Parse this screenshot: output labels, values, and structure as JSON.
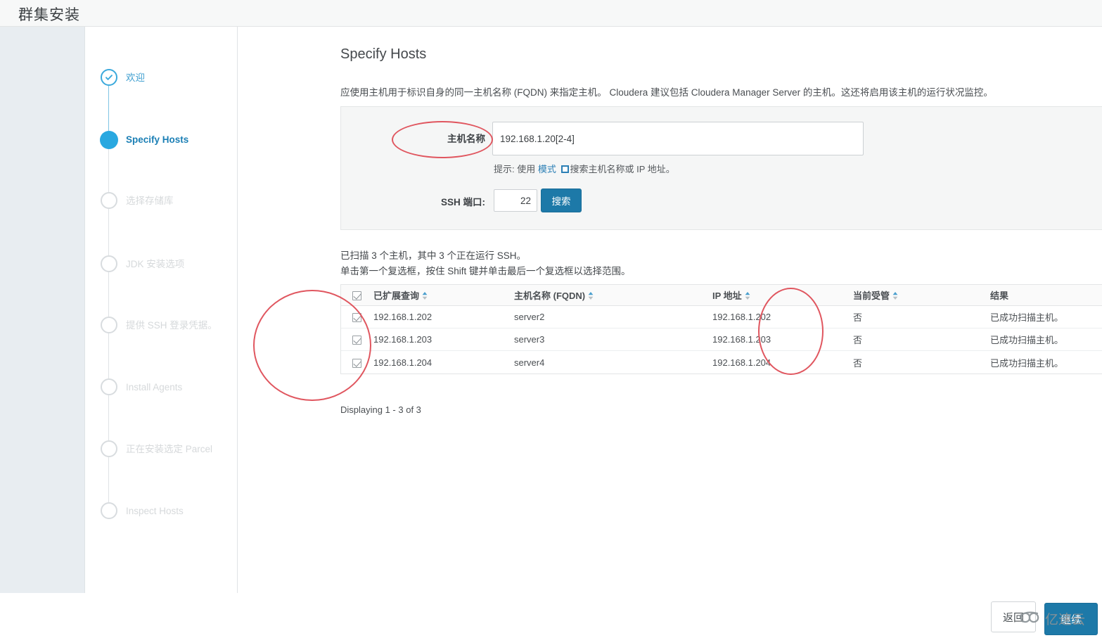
{
  "window": {
    "title": "群集安装"
  },
  "stepper": {
    "steps": [
      {
        "label": "欢迎",
        "state": "done"
      },
      {
        "label": "Specify Hosts",
        "state": "active"
      },
      {
        "label": "选择存储库",
        "state": "todo"
      },
      {
        "label": "JDK 安装选项",
        "state": "todo"
      },
      {
        "label": "提供 SSH 登录凭据。",
        "state": "todo"
      },
      {
        "label": "Install Agents",
        "state": "todo"
      },
      {
        "label": "正在安装选定 Parcel",
        "state": "todo"
      },
      {
        "label": "Inspect Hosts",
        "state": "todo"
      }
    ]
  },
  "main": {
    "heading": "Specify Hosts",
    "description": "应使用主机用于标识自身的同一主机名称 (FQDN) 来指定主机。 Cloudera 建议包括 Cloudera Manager Server 的主机。这还将启用该主机的运行状况监控。",
    "form": {
      "hostname_label": "主机名称",
      "hostname_value": "192.168.1.20[2-4]",
      "hostname_placeholder": "",
      "hint_prefix": "提示: 使用",
      "hint_link": "模式",
      "hint_suffix": "搜索主机名称或 IP 地址。",
      "ssh_port_label": "SSH 端口:",
      "ssh_port_value": "22",
      "search_button": "搜索"
    },
    "summary_line1": "已扫描 3 个主机，其中 3 个正在运行 SSH。",
    "summary_line2": "单击第一个复选框，按住 Shift 键并单击最后一个复选框以选择范围。",
    "table": {
      "columns": [
        {
          "key": "query",
          "label": "已扩展查询",
          "sortable": true
        },
        {
          "key": "fqdn",
          "label": "主机名称 (FQDN)",
          "sortable": true
        },
        {
          "key": "ip",
          "label": "IP 地址",
          "sortable": true
        },
        {
          "key": "managed",
          "label": "当前受管",
          "sortable": true
        },
        {
          "key": "result",
          "label": "结果",
          "sortable": false
        }
      ],
      "header_checked": true,
      "rows": [
        {
          "checked": true,
          "query": "192.168.1.202",
          "fqdn": "server2",
          "ip": "192.168.1.202",
          "managed": "否",
          "result": "已成功扫描主机。"
        },
        {
          "checked": true,
          "query": "192.168.1.203",
          "fqdn": "server3",
          "ip": "192.168.1.203",
          "managed": "否",
          "result": "已成功扫描主机。"
        },
        {
          "checked": true,
          "query": "192.168.1.204",
          "fqdn": "server4",
          "ip": "192.168.1.204",
          "managed": "否",
          "result": "已成功扫描主机。"
        }
      ]
    },
    "displaying": "Displaying 1 - 3 of 3"
  },
  "footer": {
    "back_button": "返回",
    "next_button": "继续",
    "watermark_text": "亿速云"
  },
  "colors": {
    "accent_blue": "#29a8e0",
    "button_blue": "#1d79a8",
    "link_blue": "#2b7fb5",
    "annotation_red": "#e0565f",
    "page_bg": "#e8edf1",
    "panel_bg": "#f5f6f6"
  }
}
